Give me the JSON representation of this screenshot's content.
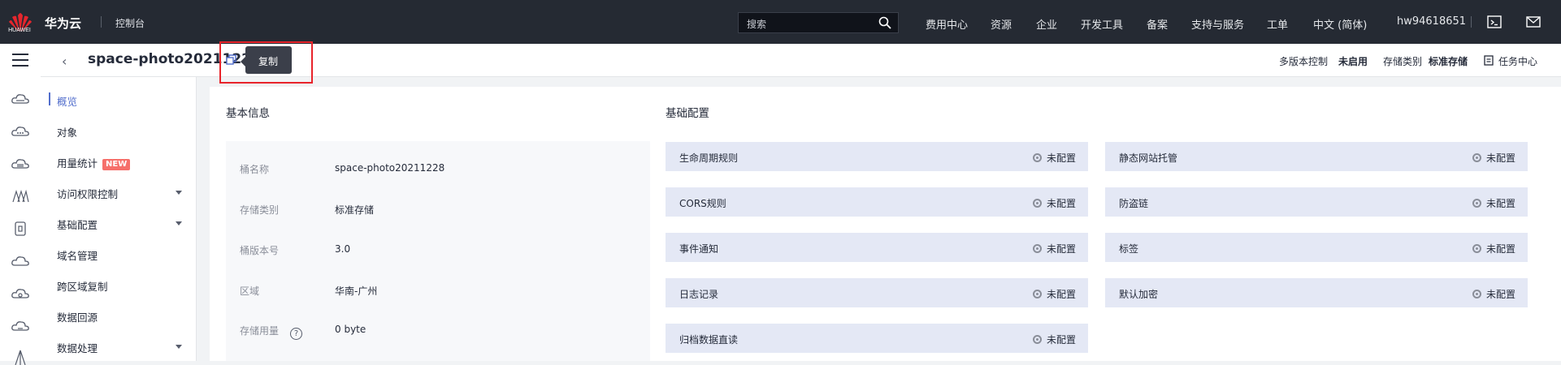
{
  "topbar": {
    "brand": "华为云",
    "logo_text": "HUAWEI",
    "console": "控制台",
    "search_placeholder": "搜索",
    "nav": [
      "费用中心",
      "资源",
      "企业",
      "开发工具",
      "备案",
      "支持与服务",
      "工单",
      "中文 (简体)",
      "hw94618651"
    ],
    "icons": [
      "terminal-icon",
      "mail-icon"
    ]
  },
  "header": {
    "bucket_name": "space-photo20211228",
    "tooltip": "复制",
    "versioning_label": "多版本控制",
    "versioning_value": "未启用",
    "storage_class_label": "存储类别",
    "storage_class_value": "标准存储",
    "task_center": "任务中心"
  },
  "sidebar": {
    "items": [
      {
        "label": "概览",
        "active": true
      },
      {
        "label": "对象"
      },
      {
        "label": "用量统计",
        "badge": "NEW"
      },
      {
        "label": "访问权限控制",
        "expandable": true
      },
      {
        "label": "基础配置",
        "expandable": true
      },
      {
        "label": "域名管理"
      },
      {
        "label": "跨区域复制"
      },
      {
        "label": "数据回源"
      },
      {
        "label": "数据处理",
        "expandable": true
      }
    ]
  },
  "basic_info": {
    "title": "基本信息",
    "rows": [
      {
        "label": "桶名称",
        "value": "space-photo20211228"
      },
      {
        "label": "存储类别",
        "value": "标准存储"
      },
      {
        "label": "桶版本号",
        "value": "3.0"
      },
      {
        "label": "区域",
        "value": "华南-广州"
      },
      {
        "label": "存储用量",
        "value": "0 byte",
        "help": "?"
      }
    ]
  },
  "basic_config": {
    "title": "基础配置",
    "left": [
      {
        "name": "生命周期规则",
        "status": "未配置"
      },
      {
        "name": "CORS规则",
        "status": "未配置"
      },
      {
        "name": "事件通知",
        "status": "未配置"
      },
      {
        "name": "日志记录",
        "status": "未配置"
      },
      {
        "name": "归档数据直读",
        "status": "未配置"
      }
    ],
    "right": [
      {
        "name": "静态网站托管",
        "status": "未配置"
      },
      {
        "name": "防盗链",
        "status": "未配置"
      },
      {
        "name": "标签",
        "status": "未配置"
      },
      {
        "name": "默认加密",
        "status": "未配置"
      }
    ]
  },
  "colors": {
    "topbar": "#252a33",
    "accent": "#526ecc",
    "badge": "#f66f6a",
    "config_row": "#e4e8f5",
    "highlight_box": "#e8242b"
  }
}
